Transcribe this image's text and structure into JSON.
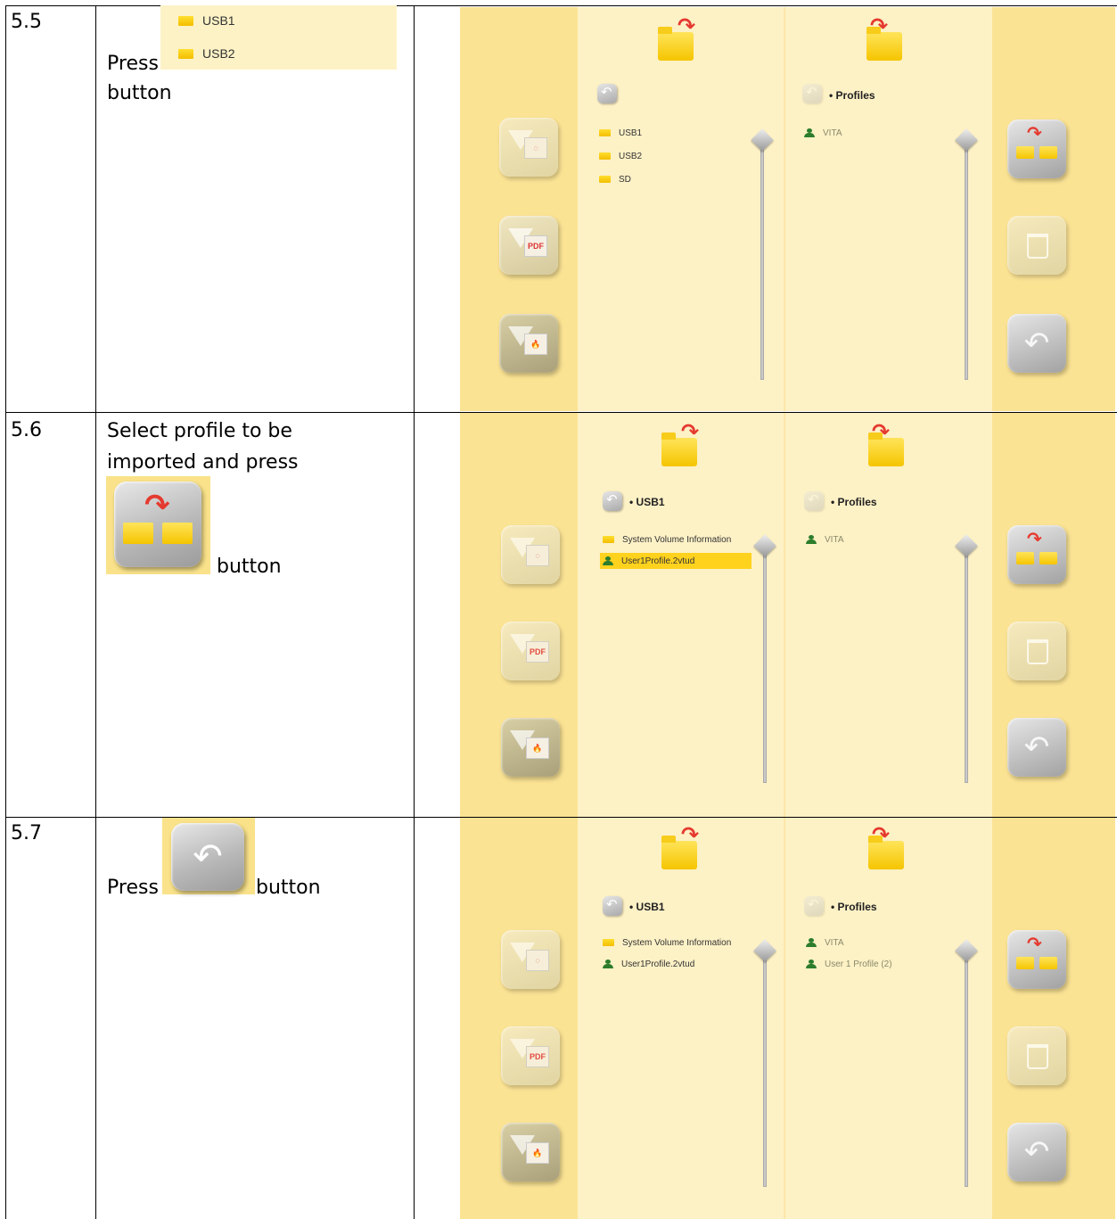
{
  "steps": [
    {
      "number": "5.5",
      "instruction": {
        "press": "Press",
        "button": "button",
        "usb_snippet": [
          "USB1",
          "USB2"
        ]
      },
      "screen": {
        "left_path": "",
        "right_path": "• Profiles",
        "left_items": [
          {
            "icon": "folder-icon",
            "label": "USB1"
          },
          {
            "icon": "folder-icon",
            "label": "USB2"
          },
          {
            "icon": "folder-icon",
            "label": "SD"
          }
        ],
        "right_items": [
          {
            "icon": "person-icon",
            "label": "VITA"
          }
        ]
      }
    },
    {
      "number": "5.6",
      "instruction": {
        "line1": "Select profile to be",
        "line2": "imported and press",
        "button": "button"
      },
      "screen": {
        "left_path": "• USB1",
        "right_path": "• Profiles",
        "left_items": [
          {
            "icon": "folder-icon",
            "label": "System Volume Information"
          },
          {
            "icon": "person-icon",
            "label": "User1Profile.2vtud",
            "selected": true
          }
        ],
        "right_items": [
          {
            "icon": "person-icon",
            "label": "VITA"
          }
        ]
      }
    },
    {
      "number": "5.7",
      "instruction": {
        "press": "Press",
        "button": "button"
      },
      "screen": {
        "left_path": "• USB1",
        "right_path": "• Profiles",
        "left_items": [
          {
            "icon": "folder-icon",
            "label": "System Volume Information"
          },
          {
            "icon": "person-icon",
            "label": "User1Profile.2vtud"
          }
        ],
        "right_items": [
          {
            "icon": "person-icon",
            "label": "VITA"
          },
          {
            "icon": "person-icon",
            "label": "User 1 Profile (2)"
          }
        ]
      }
    }
  ],
  "colors": {
    "panel_side": "#fbe394",
    "panel_center": "#fdf1c6",
    "selection": "#ffd21e",
    "folder": "#f5c500",
    "arrow": "#e53a2f"
  }
}
